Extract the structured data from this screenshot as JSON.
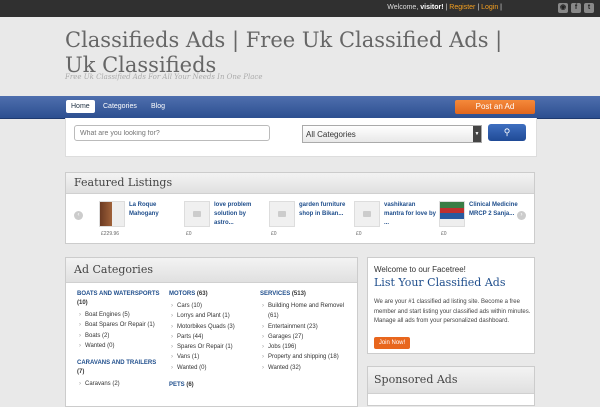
{
  "topbar": {
    "welcome_prefix": "Welcome,",
    "user": "visitor!",
    "register": "Register",
    "login": "Login",
    "icons": [
      "rss-icon",
      "facebook-icon",
      "twitter-icon"
    ]
  },
  "site": {
    "title": "Classifieds Ads | Free Uk Classified Ads | Uk Classifieds",
    "tagline": "Free Uk Classified Ads For All Your Needs In One Place"
  },
  "nav": {
    "items": [
      "Home",
      "Categories",
      "Blog"
    ],
    "post_ad": "Post an Ad"
  },
  "search": {
    "placeholder": "What are you looking for?",
    "category_selected": "All Categories",
    "button_icon": "search-icon"
  },
  "featured": {
    "title": "Featured Listings",
    "items": [
      {
        "title": "La Roque Mahogany",
        "price": "£229.96"
      },
      {
        "title": "love problem solution by astro...",
        "price": "£0"
      },
      {
        "title": "garden furniture shop in Bikan...",
        "price": "£0"
      },
      {
        "title": "vashikaran mantra for love by ...",
        "price": "£0"
      },
      {
        "title": "Clinical Medicine MRCP 2 Sanja...",
        "price": "£0"
      }
    ]
  },
  "ad_categories": {
    "title": "Ad Categories",
    "col1": {
      "heading": "BOATS AND WATERSPORTS",
      "count": "(10)",
      "items": [
        "Boat Engines (5)",
        "Boat Spares Or Repair (1)",
        "Boats (2)",
        "Wanted (0)"
      ],
      "heading2": "CARAVANS AND TRAILERS",
      "count2": "(7)",
      "items2": [
        "Caravans (2)"
      ]
    },
    "col2": {
      "heading": "MOTORS",
      "count": "(63)",
      "items": [
        "Cars (10)",
        "Lorrys and Plant (1)",
        "Motorbikes Quads (3)",
        "Parts (44)",
        "Spares Or Repair (1)",
        "Vans (1)",
        "Wanted (0)"
      ],
      "heading2": "PETS",
      "count2": "(6)"
    },
    "col3": {
      "heading": "SERVICES",
      "count": "(513)",
      "items": [
        "Building Home and Removel (61)",
        "Entertainment (23)",
        "Garages (27)",
        "Jobs (196)",
        "Property and shipping (18)",
        "Wanted (32)"
      ]
    }
  },
  "welcome_box": {
    "title": "Welcome to our Facetree!",
    "heading": "List Your Classified Ads",
    "text": "We are your #1 classified ad listing site. Become a free member and start listing your classified ads within minutes. Manage all ads from your personalized dashboard.",
    "join": "Join Now!"
  },
  "sponsored": {
    "title": "Sponsored Ads"
  }
}
